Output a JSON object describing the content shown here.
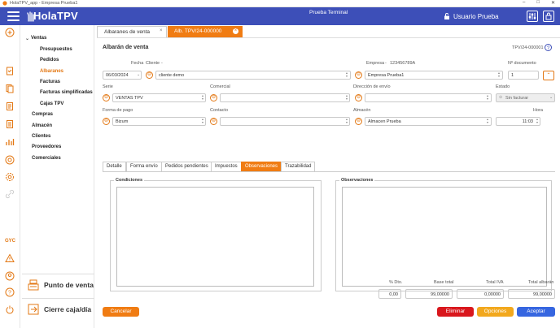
{
  "window": {
    "title": "HolaTPV_app - Empresa Prueba1"
  },
  "header": {
    "logo": "HolaTPV",
    "company": "Prueba Terminal",
    "user": "Usuario Prueba"
  },
  "sidebar": {
    "section": "Ventas",
    "sub_items": [
      "Presupuestos",
      "Pedidos",
      "Albaranes",
      "Facturas",
      "Facturas simplificadas",
      "Cajas TPV"
    ],
    "items": [
      "Compras",
      "Almacén",
      "Clientes",
      "Proveedores",
      "Comerciales"
    ],
    "rail_text": "GYC",
    "pos_button": "Punto de venta",
    "close_button": "Cierre caja/día"
  },
  "tabs": {
    "list": "Albaranes de venta",
    "doc": "Alb. TPV/24-000000"
  },
  "form": {
    "title": "Albarán de venta",
    "doc_code": "TPV/24-000001",
    "fecha_label": "Fecha",
    "fecha": "06/03/2024",
    "cliente_label": "Cliente",
    "cliente_dash": "-",
    "cliente": "cliente demo",
    "empresa_label": "Empresa",
    "empresa_sep": "-",
    "empresa_nif": "123456789A",
    "empresa": "Empresa Prueba1",
    "ndoc_label": "Nº documento",
    "ndoc": "1",
    "serie_label": "Serie",
    "serie": "VENTAS TPV",
    "comercial_label": "Comercial",
    "comercial": "",
    "direccion_label": "Dirección de envío",
    "direccion": "",
    "estado_label": "Estado",
    "estado": "Sin facturar",
    "pago_label": "Forma de pago",
    "pago": "Bizum",
    "contacto_label": "Contacto",
    "contacto": "",
    "almacen_label": "Almacén",
    "almacen": "Almacen Prueba",
    "hora_label": "Hora",
    "hora": "11:03"
  },
  "inner_tabs": [
    "Detalle",
    "Forma envío",
    "Pedidos pendientes",
    "Impuestos",
    "Observaciones",
    "Trazabilidad"
  ],
  "panels": {
    "conditions": "Condiciones",
    "observations": "Observaciones"
  },
  "totals": {
    "dto_label": "% Dto.",
    "dto": "0,00",
    "base_label": "Base total",
    "base": "99,00000",
    "iva_label": "Total IVA",
    "iva": "0,00000",
    "total_label": "Total albarán",
    "total": "99,00000"
  },
  "buttons": {
    "cancel": "Cancelar",
    "delete": "Eliminar",
    "options": "Opciones",
    "accept": "Aceptar"
  },
  "colors": {
    "brand": "#3d4fb8",
    "accent": "#f07c13",
    "danger": "#d9171d",
    "warning": "#f2a81d",
    "primary": "#3666e0"
  }
}
